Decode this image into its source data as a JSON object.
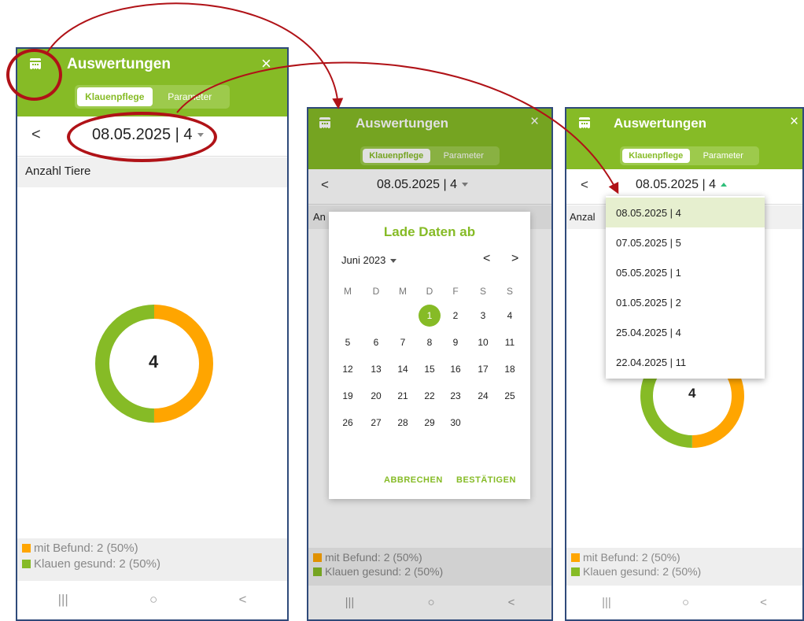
{
  "colors": {
    "accent": "#86bb26",
    "orange": "#ffa500",
    "green": "#86bb26",
    "annotation": "#b01217"
  },
  "app": {
    "title": "Auswertungen",
    "close_icon": "×",
    "calendar_icon": "calendar-icon"
  },
  "tabs": [
    {
      "label": "Klauenpflege",
      "active": true
    },
    {
      "label": "Parameter",
      "active": false
    }
  ],
  "date_selector": {
    "value": "08.05.2025 | 4",
    "prev": "<"
  },
  "section_label": "Anzahl Tiere",
  "section_label_partial_2": "An",
  "section_label_partial_3": "Anzal",
  "donut": {
    "center_value": "4",
    "mit_befund": 2,
    "klauen_gesund": 2
  },
  "legend": [
    {
      "label": "mit Befund: 2 (50%)",
      "color": "#ffa500"
    },
    {
      "label": "Klauen gesund: 2 (50%)",
      "color": "#86bb26"
    }
  ],
  "navbar": {
    "recents": "|||",
    "home": "○",
    "back": "<"
  },
  "calendar_dialog": {
    "title": "Lade Daten ab",
    "month_label": "Juni 2023",
    "prev": "<",
    "next": ">",
    "weekdays": [
      "M",
      "D",
      "M",
      "D",
      "F",
      "S",
      "S"
    ],
    "weeks": [
      [
        "",
        "",
        "",
        "1",
        "2",
        "3",
        "4"
      ],
      [
        "5",
        "6",
        "7",
        "8",
        "9",
        "10",
        "11"
      ],
      [
        "12",
        "13",
        "14",
        "15",
        "16",
        "17",
        "18"
      ],
      [
        "19",
        "20",
        "21",
        "22",
        "23",
        "24",
        "25"
      ],
      [
        "26",
        "27",
        "28",
        "29",
        "30",
        "",
        ""
      ]
    ],
    "selected_day": "1",
    "cancel": "ABBRECHEN",
    "confirm": "BESTÄTIGEN"
  },
  "dropdown_options": [
    "08.05.2025 | 4",
    "07.05.2025 | 5",
    "05.05.2025 | 1",
    "01.05.2025 | 2",
    "25.04.2025 | 4",
    "22.04.2025 | 11"
  ],
  "selected_option": "08.05.2025 | 4"
}
